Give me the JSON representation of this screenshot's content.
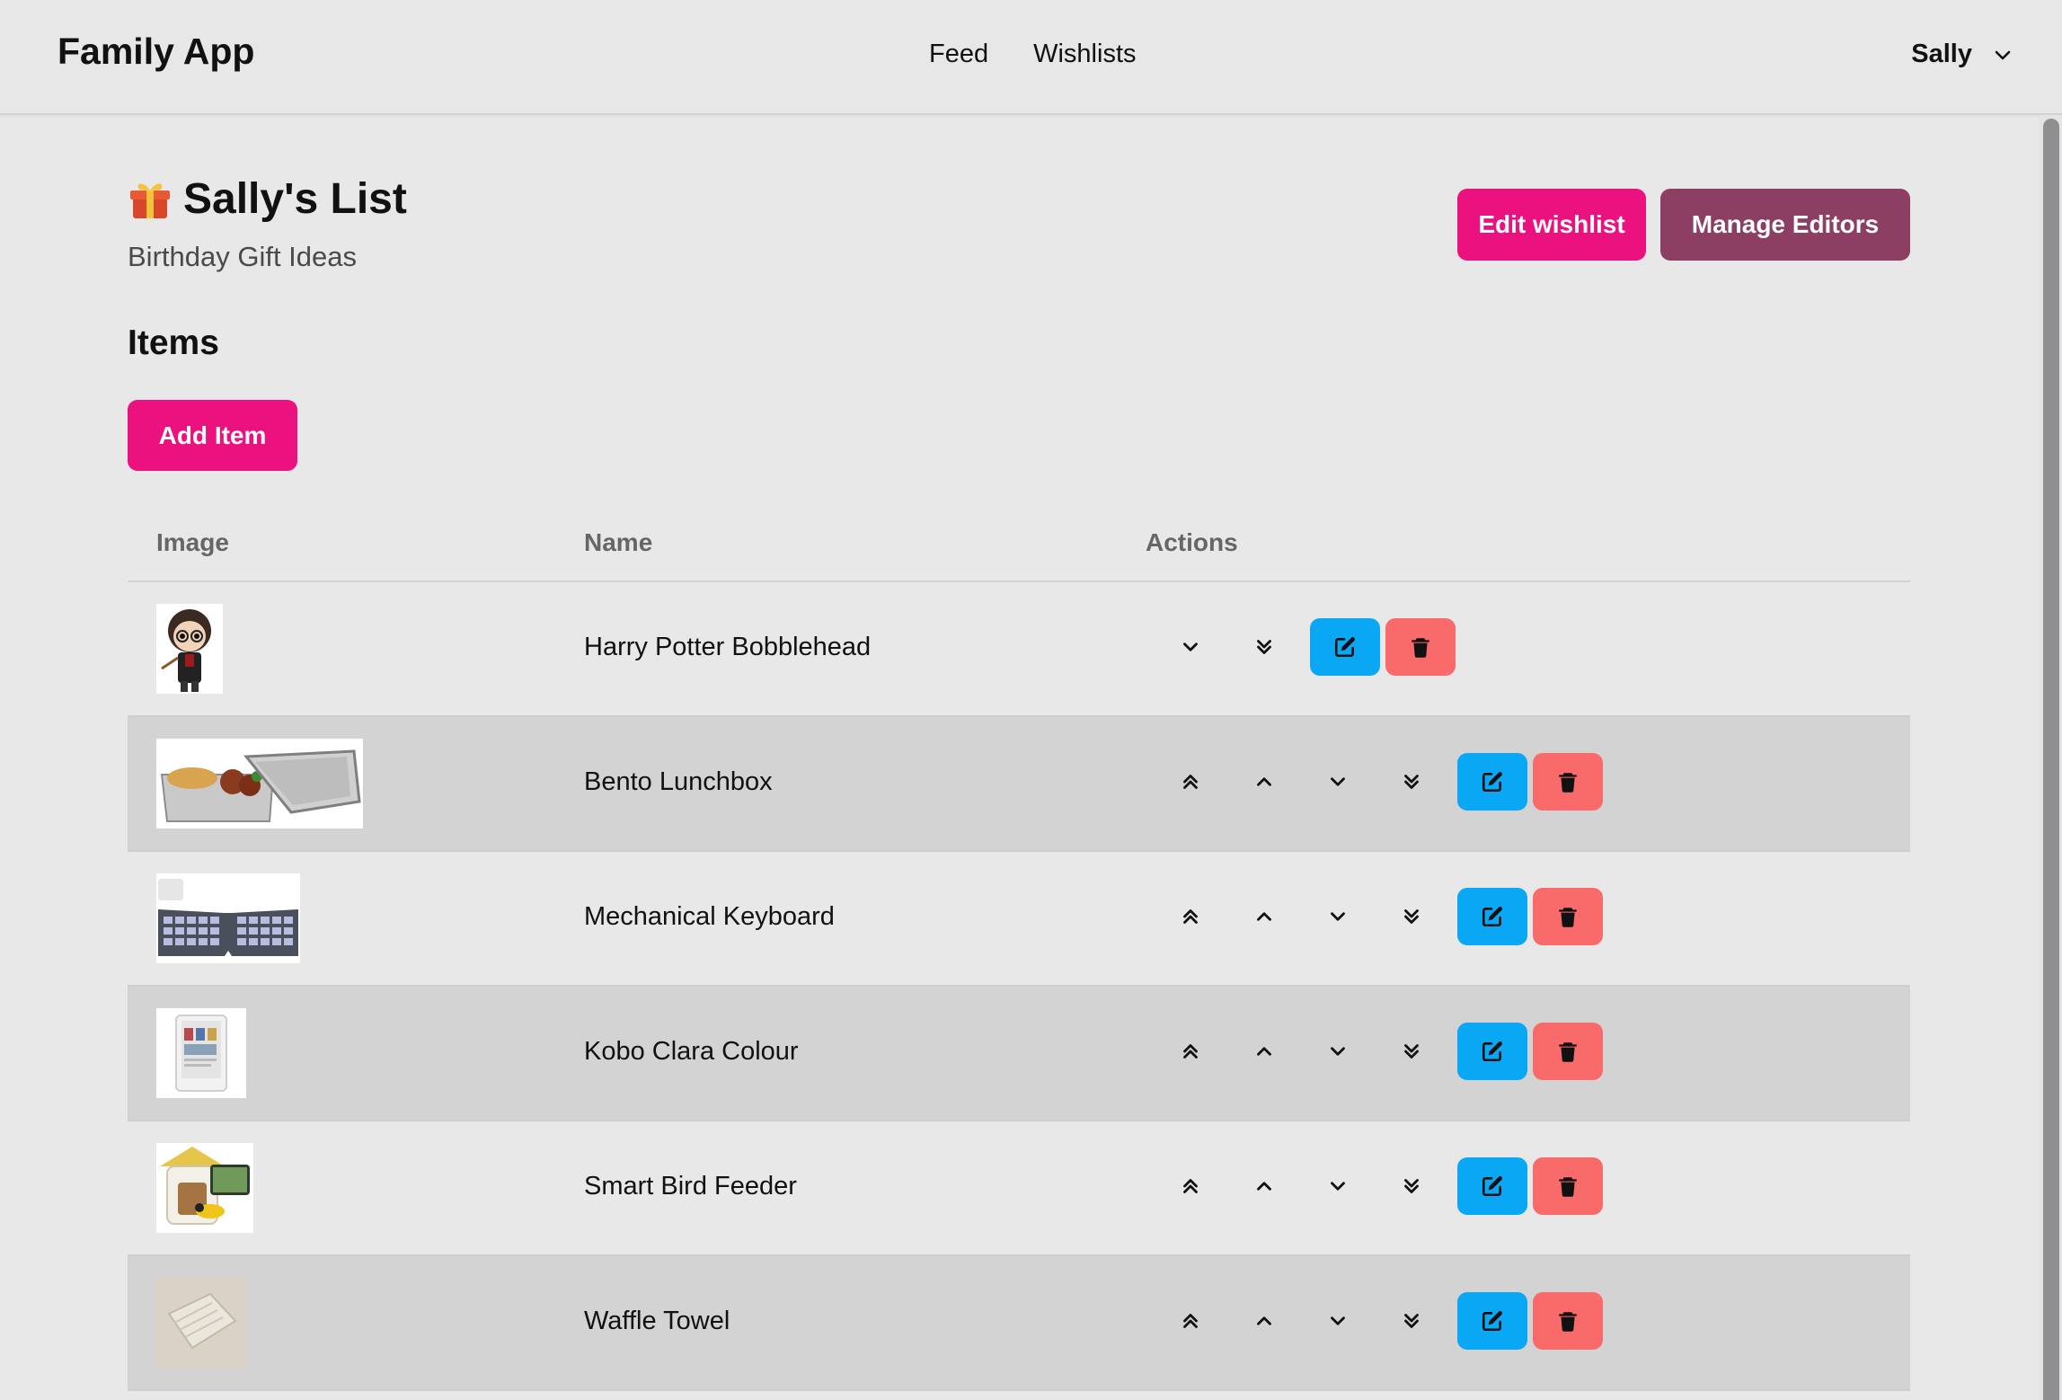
{
  "app": {
    "brand": "Family App"
  },
  "nav": {
    "links": [
      "Feed",
      "Wishlists"
    ],
    "user": "Sally"
  },
  "page": {
    "title": "Sally's List",
    "subtitle": "Birthday Gift Ideas",
    "edit_wishlist": "Edit wishlist",
    "manage_editors": "Manage Editors",
    "items_heading": "Items",
    "add_item": "Add Item"
  },
  "table": {
    "headers": [
      "Image",
      "Name",
      "Actions"
    ],
    "rows": [
      {
        "name": "Harry Potter Bobblehead",
        "image": "bobblehead-figure"
      },
      {
        "name": "Bento Lunchbox",
        "image": "steel-lunchbox"
      },
      {
        "name": "Mechanical Keyboard",
        "image": "split-keyboard"
      },
      {
        "name": "Kobo Clara Colour",
        "image": "ereader"
      },
      {
        "name": "Smart Bird Feeder",
        "image": "bird-feeder"
      },
      {
        "name": "Waffle Towel",
        "image": "folded-towel"
      }
    ]
  },
  "colors": {
    "primary": "#eb1280",
    "secondary": "#8c3f62",
    "edit": "#0aa7f5",
    "delete": "#f96a6a"
  }
}
